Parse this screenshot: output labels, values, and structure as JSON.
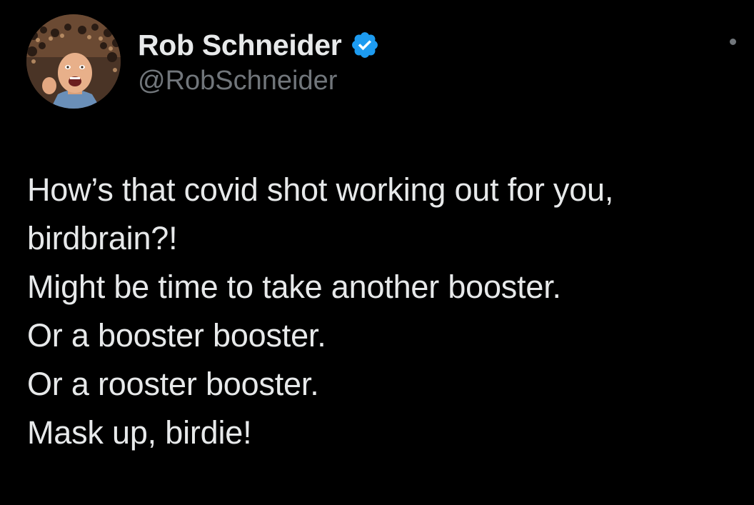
{
  "author": {
    "display_name": "Rob Schneider",
    "handle": "@RobSchneider",
    "verified": true,
    "verified_color": "#1d9bf0"
  },
  "tweet": {
    "lines": [
      "How’s that covid shot working out for you,",
      "birdbrain?!",
      "Might be time to take another booster.",
      "Or a booster booster.",
      "Or a rooster booster.",
      "Mask up, birdie!"
    ]
  },
  "icons": {
    "avatar": "profile-photo",
    "verified": "verified-badge-icon",
    "more": "more-options-icon"
  },
  "colors": {
    "background": "#000000",
    "text_primary": "#e7e9ea",
    "text_secondary": "#71767b"
  }
}
